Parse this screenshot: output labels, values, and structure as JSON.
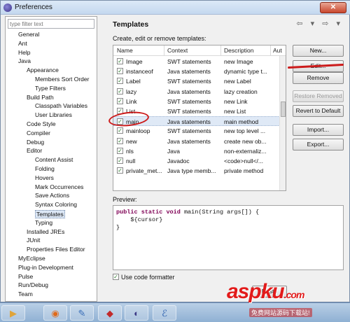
{
  "window": {
    "title": "Preferences",
    "close_glyph": "✕"
  },
  "filter": {
    "placeholder": "type filter text"
  },
  "tree": [
    "General",
    "Ant",
    "Help",
    "Java",
    "Appearance",
    "Members Sort Order",
    "Type Filters",
    "Build Path",
    "Classpath Variables",
    "User Libraries",
    "Code Style",
    "Compiler",
    "Debug",
    "Editor",
    "Content Assist",
    "Folding",
    "Hovers",
    "Mark Occurrences",
    "Save Actions",
    "Syntax Coloring",
    "Templates",
    "Typing",
    "Installed JREs",
    "JUnit",
    "Properties Files Editor",
    "MyEclipse",
    "Plug-in Development",
    "Pulse",
    "Run/Debug",
    "Team"
  ],
  "page": {
    "title": "Templates",
    "description": "Create, edit or remove templates:",
    "nav_arrows": "⇦ ▾ ⇨ ▾"
  },
  "table": {
    "headers": [
      "Name",
      "Context",
      "Description",
      "Aut"
    ],
    "rows": [
      {
        "name": "Image",
        "context": "SWT statements",
        "description": "new Image",
        "checked": true
      },
      {
        "name": "instanceof",
        "context": "Java statements",
        "description": "dynamic type t...",
        "checked": true
      },
      {
        "name": "Label",
        "context": "SWT statements",
        "description": "new Label",
        "checked": true
      },
      {
        "name": "lazy",
        "context": "Java statements",
        "description": "lazy creation",
        "checked": true
      },
      {
        "name": "Link",
        "context": "SWT statements",
        "description": "new Link",
        "checked": true
      },
      {
        "name": "List",
        "context": "SWT statements",
        "description": "new List",
        "checked": true
      },
      {
        "name": "main",
        "context": "Java statements",
        "description": "main method",
        "checked": true
      },
      {
        "name": "mainloop",
        "context": "SWT statements",
        "description": "new top level ...",
        "checked": true
      },
      {
        "name": "new",
        "context": "Java statements",
        "description": "create new ob...",
        "checked": true
      },
      {
        "name": "nls",
        "context": "Java",
        "description": "non-externaliz...",
        "checked": true
      },
      {
        "name": "null",
        "context": "Javadoc",
        "description": "<code>null</...",
        "checked": true
      },
      {
        "name": "private_met...",
        "context": "Java type memb...",
        "description": "private method",
        "checked": true
      }
    ],
    "selected_index": 6
  },
  "buttons": {
    "new": "New...",
    "edit": "Edit...",
    "remove": "Remove",
    "restore_removed": "Restore Removed",
    "revert_default": "Revert to Default",
    "import": "Import...",
    "export": "Export...",
    "restore": "Resto"
  },
  "preview": {
    "label": "Preview:",
    "keyword1": "public",
    "keyword2": "static",
    "keyword3": "void",
    "line1_rest": "main(String args[]) {",
    "line2": "    ${cursor}",
    "line3": "}"
  },
  "formatter": {
    "label": "Use code formatter",
    "checked": true
  },
  "taskbar": {
    "items": [
      "media-player-icon",
      "browser-icon",
      "paint-icon",
      "eraser-app-icon",
      "eclipse-icon",
      "myeclipse-icon"
    ],
    "glyphs": [
      "▶",
      "◉",
      "✎",
      "◆",
      "◐",
      "ℰ"
    ]
  },
  "watermark": {
    "brand": "aspku",
    "tld": ".com",
    "tagline": "免费网站源码下载站!"
  },
  "colors": {
    "keyword": "#7f0055",
    "accent_annotation": "#cc1b1b",
    "selection": "#dfe9f6"
  }
}
